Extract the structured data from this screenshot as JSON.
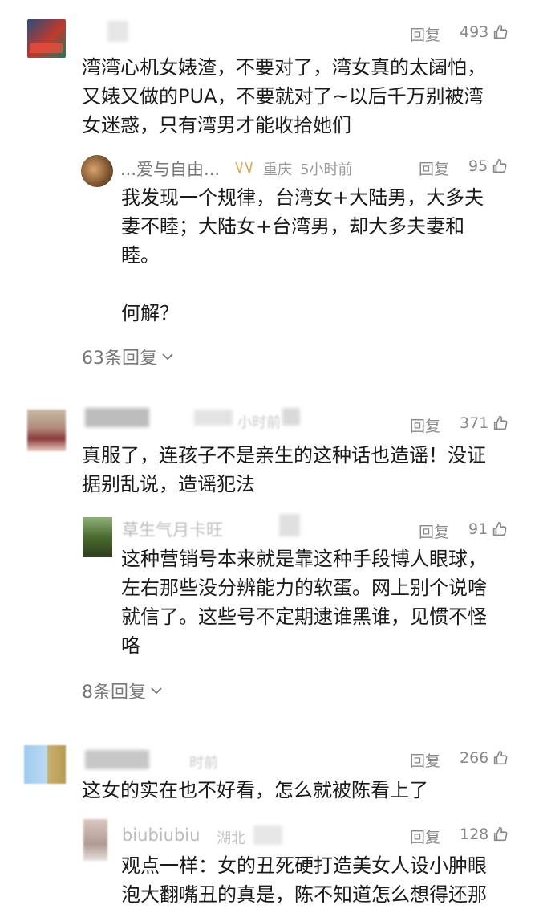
{
  "comments": [
    {
      "content": "湾湾心机女婊渣，不要对了，湾女真的太阔怕，\n又婊又做的PUA，不要就对了~以后千万别被湾\n女迷惑，只有湾男才能收拾她们",
      "reply_label": "回复",
      "likes": "493",
      "reply": {
        "name": "...爱与自由...",
        "location": "重庆",
        "time": "5小时前",
        "reply_label": "回复",
        "likes": "95",
        "content": "我发现一个规律，台湾女+大陆男，大多夫\n妻不睦；大陆女+台湾男，却大多夫妻和\n睦。\n\n何解？"
      },
      "more_replies": "63条回复"
    },
    {
      "time_fragment": "小时前",
      "content": "真服了，连孩子不是亲生的这种话也造谣！没证\n据别乱说，造谣犯法",
      "reply_label": "回复",
      "likes": "371",
      "reply": {
        "name": "草生气月卡旺",
        "reply_label": "回复",
        "likes": "91",
        "content": "这种营销号本来就是靠这种手段博人眼球，\n左右那些没分辨能力的软蛋。网上别个说啥\n就信了。这些号不定期逮谁黑谁，见惯不怪\n咯"
      },
      "more_replies": "8条回复"
    },
    {
      "time_fragment": "时前",
      "content": "这女的实在也不好看，怎么就被陈看上了",
      "reply_label": "回复",
      "likes": "266",
      "reply": {
        "name": "biubiubiu",
        "location": "湖北",
        "reply_label": "回复",
        "likes": "128",
        "content": "观点一样：女的丑死硬打造美女人设小肿眼\n泡大翻嘴丑的真是，陈不知道怎么想得还那"
      }
    }
  ],
  "icons": {
    "like": "thumbs-up-icon",
    "expand": "chevron-down-icon",
    "badge": "vip-badge-icon"
  },
  "colors": {
    "text": "#1a1a1a",
    "muted": "#888888",
    "background": "#ffffff"
  }
}
